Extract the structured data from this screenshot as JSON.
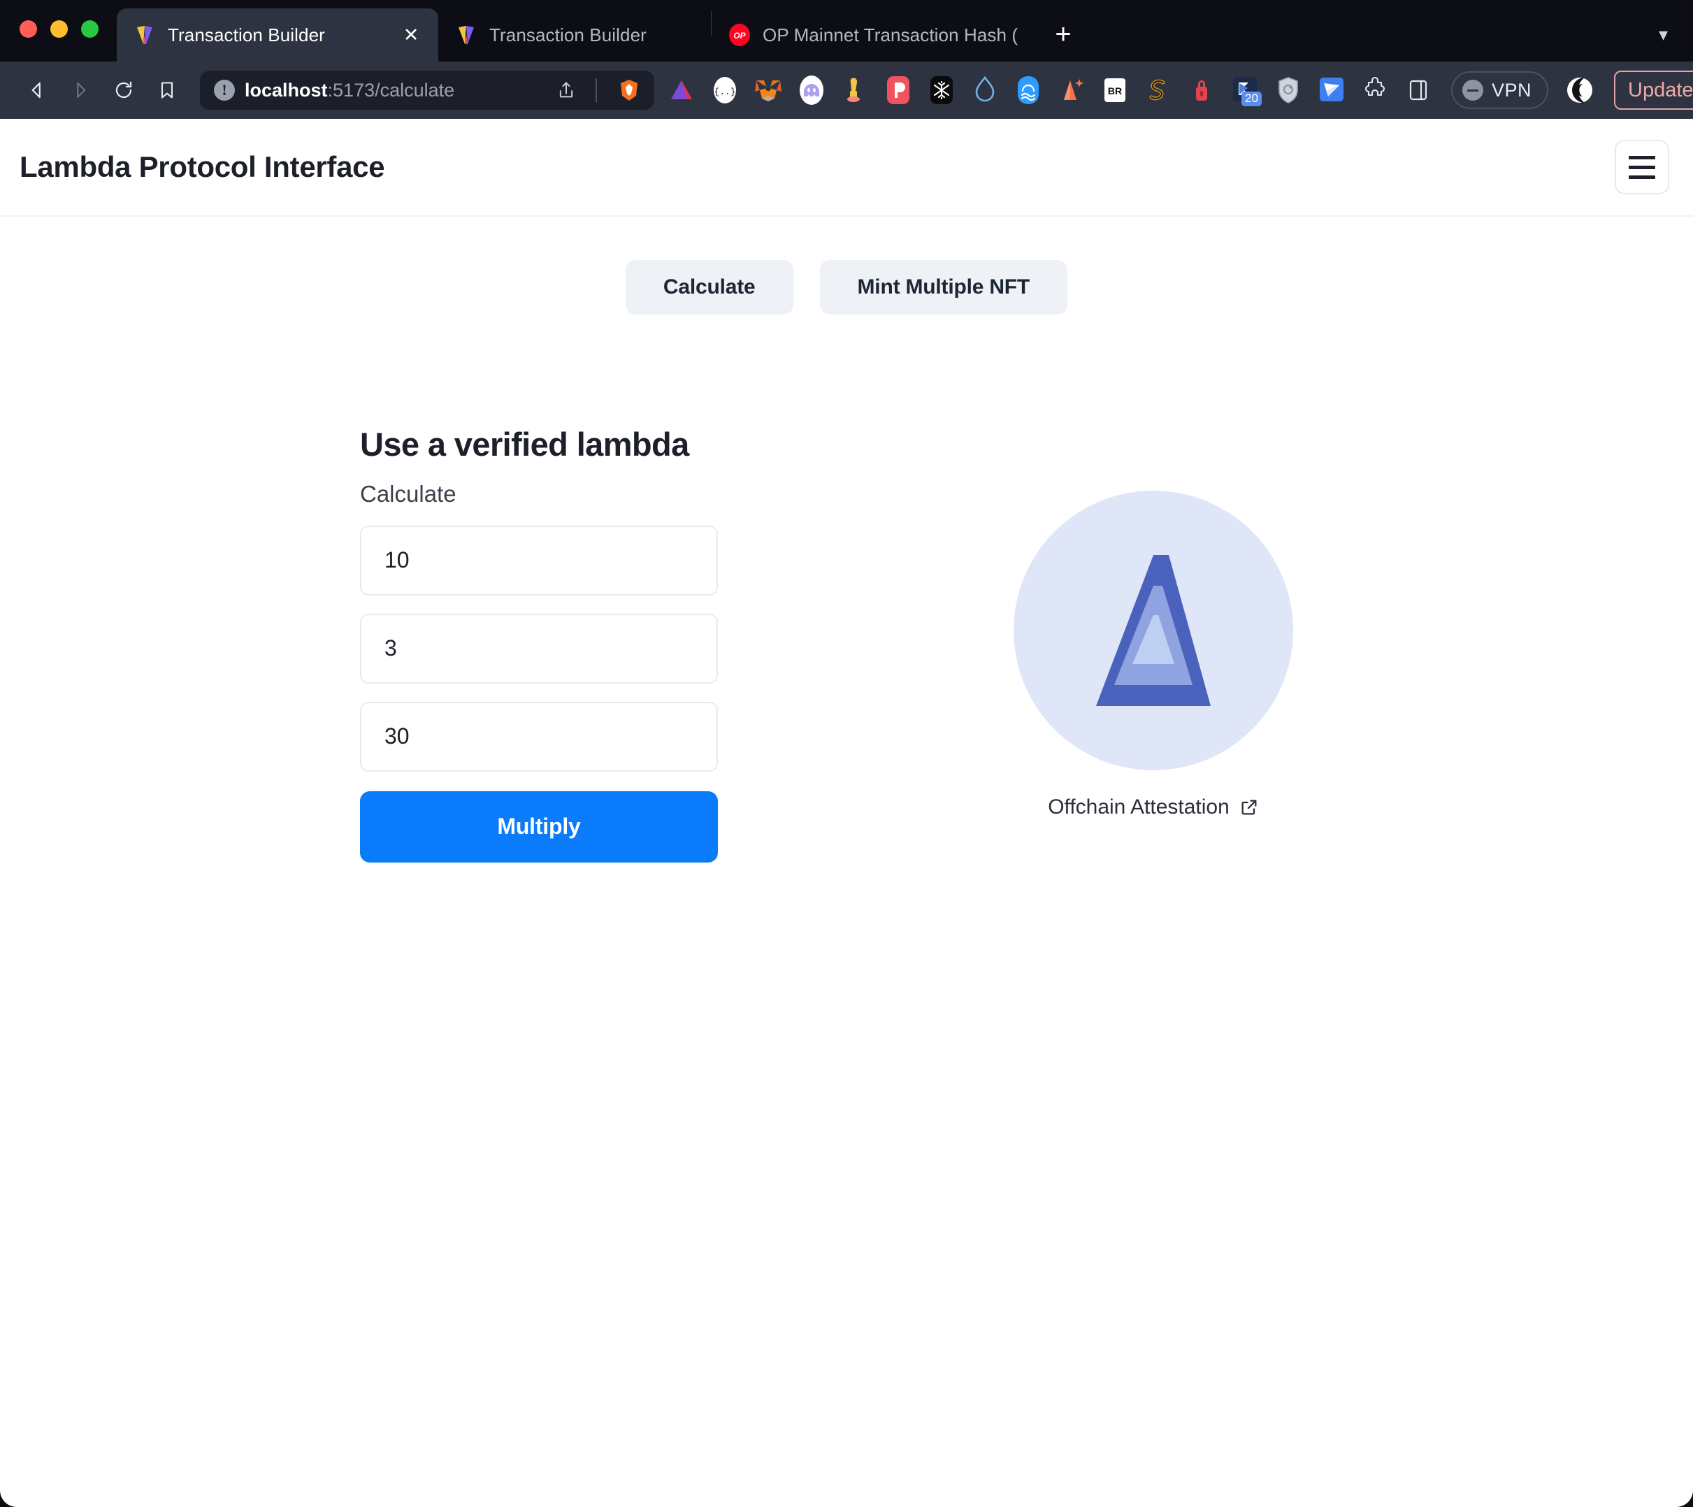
{
  "browser": {
    "window_controls": [
      "close",
      "minimize",
      "maximize"
    ],
    "tabs": [
      {
        "title": "Transaction Builder",
        "favicon": "lambda-prism-icon",
        "active": true,
        "closable": true
      },
      {
        "title": "Transaction Builder",
        "favicon": "lambda-prism-icon",
        "active": false,
        "closable": false
      },
      {
        "title": "OP Mainnet Transaction Hash (Txha",
        "favicon": "optimism-icon",
        "active": false,
        "closable": false
      }
    ],
    "new_tab_label": "+",
    "tab_list_chevron": "chevron-down-icon",
    "toolbar": {
      "back": "back-arrow-icon",
      "forward": "forward-arrow-icon",
      "reload": "reload-icon",
      "bookmark": "bookmark-icon",
      "url_host": "localhost",
      "url_path": ":5173/calculate",
      "url_full": "localhost:5173/calculate",
      "site_info_icon": "not-secure-info-icon",
      "share_icon": "share-icon",
      "brave_icon": "brave-shield-icon",
      "extensions": [
        "triangle-red-icon",
        "json-viewer-icon",
        "metamask-fox-icon",
        "phantom-ghost-icon",
        "rabby-icon",
        "pocket-universe-icon",
        "snowflake-icon",
        "water-drop-icon",
        "ocean-icon",
        "ava-star-icon",
        "br-icon",
        "snake-s-icon",
        "red-lock-icon",
        "ledger-20-icon",
        "shield-privacy-icon",
        "blue-paper-plane-icon",
        "puzzle-extensions-icon",
        "sidebar-panel-icon"
      ],
      "badge_count": "20",
      "vpn_label": "VPN",
      "vpn_state_icon": "vpn-off-icon",
      "moon_icon": "dark-mode-icon",
      "update_label": "Update",
      "menu_icon": "browser-menu-icon"
    }
  },
  "page": {
    "header": {
      "title": "Lambda Protocol Interface",
      "menu_icon": "hamburger-menu-icon"
    },
    "nav_tabs": [
      {
        "label": "Calculate",
        "active": true
      },
      {
        "label": "Mint Multiple NFT",
        "active": false
      }
    ],
    "form": {
      "heading": "Use a verified lambda",
      "subheading": "Calculate",
      "fields": [
        {
          "name": "operand-one",
          "value": "10"
        },
        {
          "name": "operand-two",
          "value": "3"
        },
        {
          "name": "operand-three",
          "value": "30"
        }
      ],
      "submit_label": "Multiply"
    },
    "brand": {
      "logo_icon": "lambda-nested-triangle-logo",
      "attestation_label": "Offchain Attestation",
      "attestation_icon": "external-link-icon",
      "colors": {
        "circle_bg": "#dfe6f7",
        "triangle_outer": "#4b62bd",
        "triangle_mid": "#8fa3e0",
        "triangle_inner": "#bed0f2"
      }
    },
    "colors": {
      "accent": "#0a7cfb",
      "nav_tab_bg": "#eef1f6",
      "text_primary": "#1d2028",
      "field_border": "#e8eaee"
    }
  }
}
